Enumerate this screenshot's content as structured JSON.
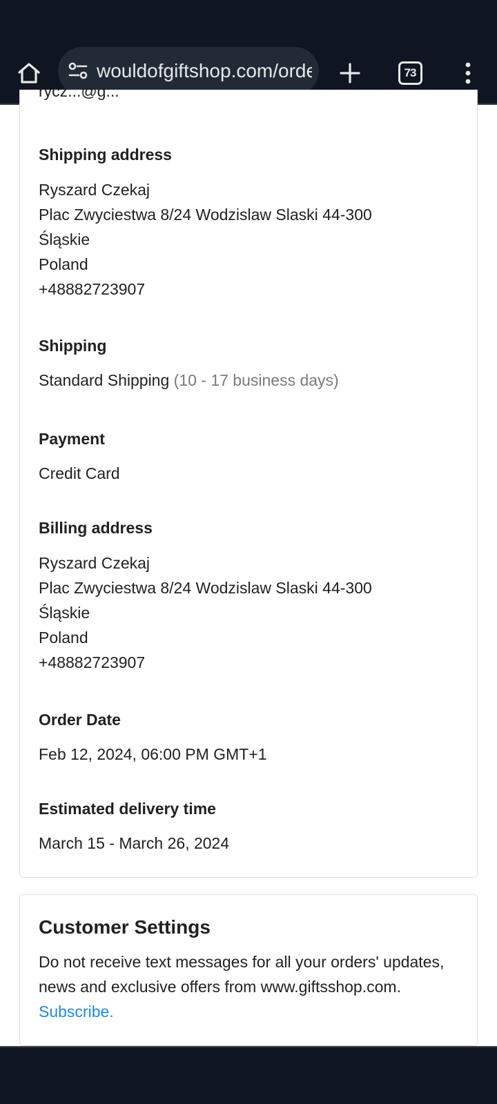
{
  "browser": {
    "url": "wouldofgiftshop.com/order",
    "tab_count": "73"
  },
  "order": {
    "partial_line": "rycz...@g...",
    "shipping_address": {
      "heading": "Shipping address",
      "name": "Ryszard Czekaj",
      "street": "Plac Zwyciestwa 8/24 Wodzislaw Slaski 44-300",
      "region": "Śląskie",
      "country": "Poland",
      "phone": "+48882723907"
    },
    "shipping": {
      "heading": "Shipping",
      "method": "Standard Shipping",
      "duration": "(10 - 17 business days)"
    },
    "payment": {
      "heading": "Payment",
      "method": "Credit Card"
    },
    "billing_address": {
      "heading": "Billing address",
      "name": "Ryszard Czekaj",
      "street": "Plac Zwyciestwa 8/24 Wodzislaw Slaski 44-300",
      "region": "Śląskie",
      "country": "Poland",
      "phone": "+48882723907"
    },
    "order_date": {
      "heading": "Order Date",
      "value": "Feb 12, 2024, 06:00 PM GMT+1"
    },
    "delivery": {
      "heading": "Estimated delivery time",
      "value": "March 15 - March 26, 2024"
    }
  },
  "settings": {
    "title": "Customer Settings",
    "text": "Do not receive text messages for all your orders' updates, news and exclusive offers from www.giftsshop.com.",
    "link": "Subscribe."
  },
  "colors": {
    "chrome_bg": "#0f1621",
    "url_pill": "#222b35",
    "link": "#1a8ae5",
    "muted_text": "#7a7a7a"
  }
}
